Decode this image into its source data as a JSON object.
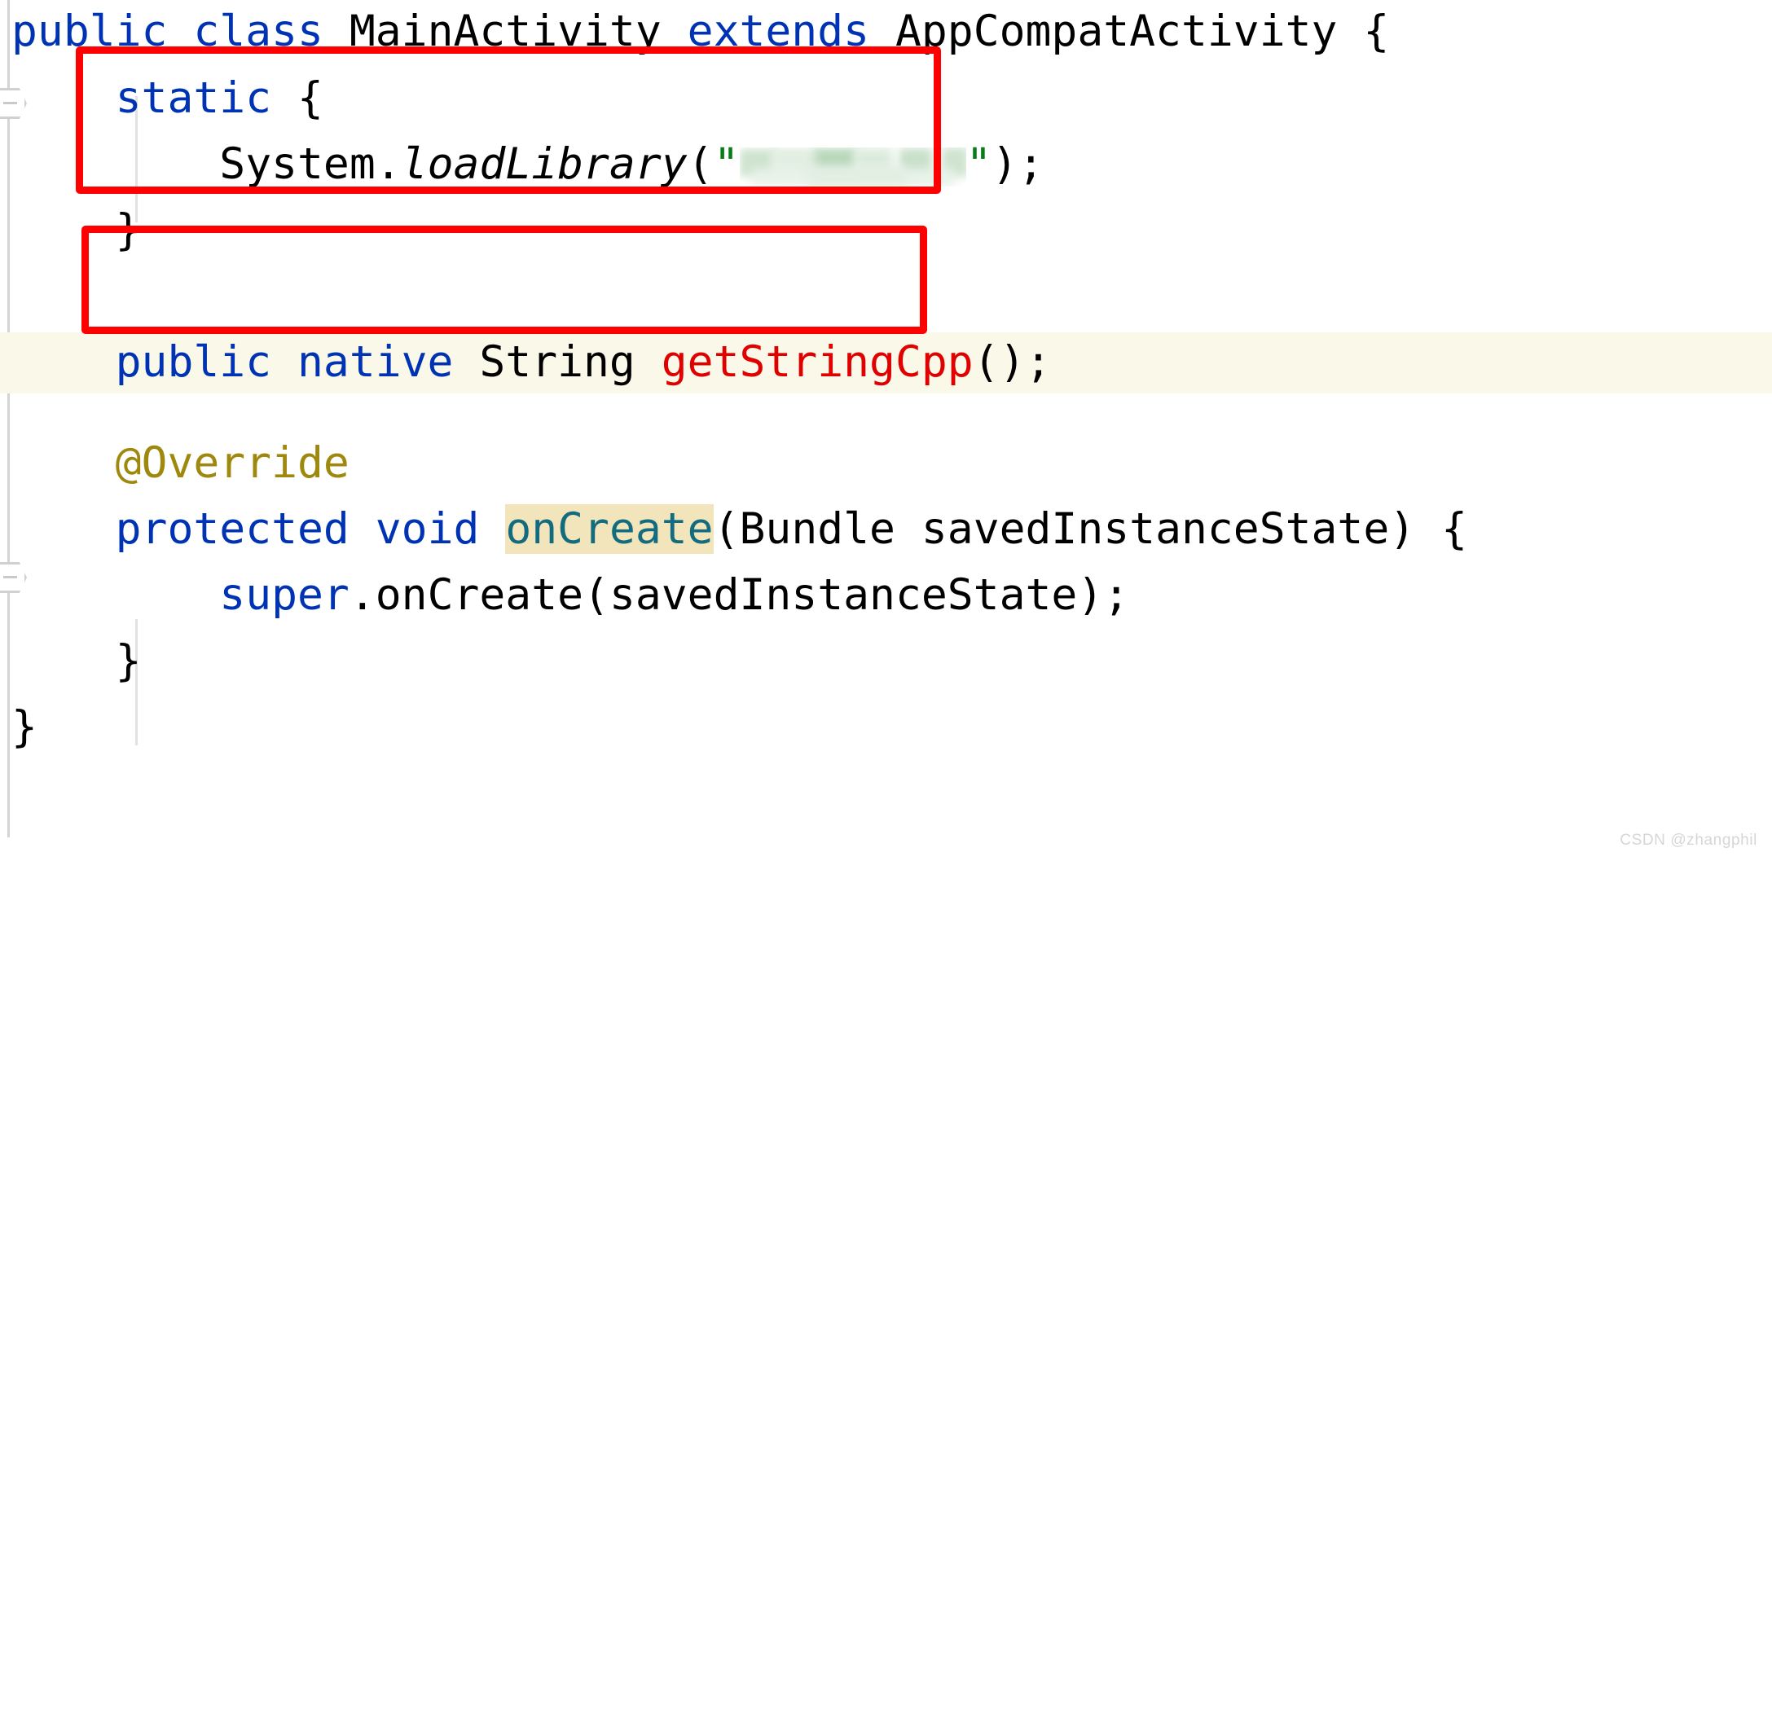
{
  "editor": {
    "language": "java",
    "background": "#ffffff",
    "caret_line_background": "#faf8e9",
    "font_size_px": 53
  },
  "colors": {
    "keyword": "#0033b3",
    "identifier": "#000000",
    "declared_method": "#e00000",
    "annotation": "#9e880d",
    "string": "#067d17",
    "usage_highlight_text": "#126b7e",
    "usage_highlight_background": "#f2e5bb",
    "annotation_box": "#fe0000",
    "gutter_line": "#d4d4d4",
    "indent_guide": "#e2e2e2"
  },
  "code": {
    "line1": {
      "kw_public": "public",
      "sp1": " ",
      "kw_class": "class",
      "sp2": " ",
      "name": "MainActivity",
      "sp3": " ",
      "kw_extends": "extends",
      "sp4": " ",
      "superclass": "AppCompatActivity",
      "brace": " {"
    },
    "line2": {
      "indent": "    ",
      "kw_static": "static",
      "brace": " {"
    },
    "line3": {
      "indent": "        ",
      "receiver": "System.",
      "method": "loadLibrary",
      "open": "(",
      "quote_open": "\"",
      "redacted_value": "",
      "quote_close": "\"",
      "close": ");"
    },
    "line4": {
      "indent": "    ",
      "brace": "}"
    },
    "line5": {
      "indent": "    ",
      "annotation_visible": ""
    },
    "line6": {
      "indent": "    ",
      "kw_public": "public",
      "sp1": " ",
      "kw_native": "native",
      "sp2": " ",
      "type": "String",
      "sp3": " ",
      "method": "getStringCpp",
      "tail": "();"
    },
    "line7": {
      "indent": "    ",
      "annotation": "@Override"
    },
    "line8": {
      "indent": "    ",
      "kw_protected": "protected",
      "sp1": " ",
      "kw_void": "void",
      "sp2": " ",
      "method": "onCreate",
      "open": "(",
      "param_type": "Bundle",
      "sp3": " ",
      "param_name": "savedInstanceState",
      "close": ") {"
    },
    "line9": {
      "indent": "        ",
      "kw_super": "super",
      "dot": ".",
      "method": "onCreate",
      "open": "(",
      "arg": "savedInstanceState",
      "close": ");"
    },
    "line10": {
      "indent": "    ",
      "brace": "}"
    },
    "line11": {
      "brace": "}"
    }
  },
  "annotations": {
    "box1_label": "static-block-highlight",
    "box2_label": "native-method-highlight"
  },
  "watermark": {
    "text": "CSDN @zhangphil"
  }
}
